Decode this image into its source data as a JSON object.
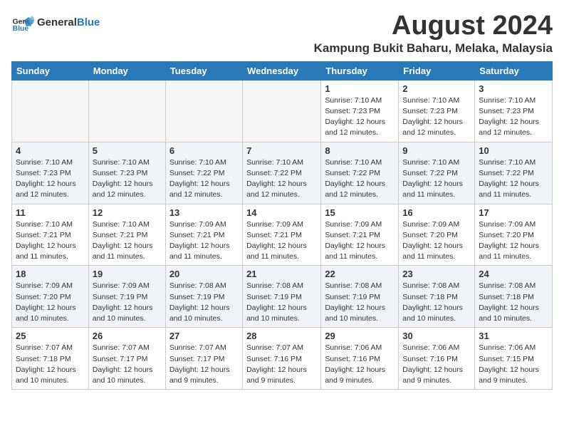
{
  "logo": {
    "general": "General",
    "blue": "Blue"
  },
  "header": {
    "title": "August 2024",
    "subtitle": "Kampung Bukit Baharu, Melaka, Malaysia"
  },
  "weekdays": [
    "Sunday",
    "Monday",
    "Tuesday",
    "Wednesday",
    "Thursday",
    "Friday",
    "Saturday"
  ],
  "weeks": [
    [
      {
        "day": "",
        "info": ""
      },
      {
        "day": "",
        "info": ""
      },
      {
        "day": "",
        "info": ""
      },
      {
        "day": "",
        "info": ""
      },
      {
        "day": "1",
        "info": "Sunrise: 7:10 AM\nSunset: 7:23 PM\nDaylight: 12 hours\nand 12 minutes."
      },
      {
        "day": "2",
        "info": "Sunrise: 7:10 AM\nSunset: 7:23 PM\nDaylight: 12 hours\nand 12 minutes."
      },
      {
        "day": "3",
        "info": "Sunrise: 7:10 AM\nSunset: 7:23 PM\nDaylight: 12 hours\nand 12 minutes."
      }
    ],
    [
      {
        "day": "4",
        "info": "Sunrise: 7:10 AM\nSunset: 7:23 PM\nDaylight: 12 hours\nand 12 minutes."
      },
      {
        "day": "5",
        "info": "Sunrise: 7:10 AM\nSunset: 7:23 PM\nDaylight: 12 hours\nand 12 minutes."
      },
      {
        "day": "6",
        "info": "Sunrise: 7:10 AM\nSunset: 7:22 PM\nDaylight: 12 hours\nand 12 minutes."
      },
      {
        "day": "7",
        "info": "Sunrise: 7:10 AM\nSunset: 7:22 PM\nDaylight: 12 hours\nand 12 minutes."
      },
      {
        "day": "8",
        "info": "Sunrise: 7:10 AM\nSunset: 7:22 PM\nDaylight: 12 hours\nand 12 minutes."
      },
      {
        "day": "9",
        "info": "Sunrise: 7:10 AM\nSunset: 7:22 PM\nDaylight: 12 hours\nand 11 minutes."
      },
      {
        "day": "10",
        "info": "Sunrise: 7:10 AM\nSunset: 7:22 PM\nDaylight: 12 hours\nand 11 minutes."
      }
    ],
    [
      {
        "day": "11",
        "info": "Sunrise: 7:10 AM\nSunset: 7:21 PM\nDaylight: 12 hours\nand 11 minutes."
      },
      {
        "day": "12",
        "info": "Sunrise: 7:10 AM\nSunset: 7:21 PM\nDaylight: 12 hours\nand 11 minutes."
      },
      {
        "day": "13",
        "info": "Sunrise: 7:09 AM\nSunset: 7:21 PM\nDaylight: 12 hours\nand 11 minutes."
      },
      {
        "day": "14",
        "info": "Sunrise: 7:09 AM\nSunset: 7:21 PM\nDaylight: 12 hours\nand 11 minutes."
      },
      {
        "day": "15",
        "info": "Sunrise: 7:09 AM\nSunset: 7:21 PM\nDaylight: 12 hours\nand 11 minutes."
      },
      {
        "day": "16",
        "info": "Sunrise: 7:09 AM\nSunset: 7:20 PM\nDaylight: 12 hours\nand 11 minutes."
      },
      {
        "day": "17",
        "info": "Sunrise: 7:09 AM\nSunset: 7:20 PM\nDaylight: 12 hours\nand 11 minutes."
      }
    ],
    [
      {
        "day": "18",
        "info": "Sunrise: 7:09 AM\nSunset: 7:20 PM\nDaylight: 12 hours\nand 10 minutes."
      },
      {
        "day": "19",
        "info": "Sunrise: 7:09 AM\nSunset: 7:19 PM\nDaylight: 12 hours\nand 10 minutes."
      },
      {
        "day": "20",
        "info": "Sunrise: 7:08 AM\nSunset: 7:19 PM\nDaylight: 12 hours\nand 10 minutes."
      },
      {
        "day": "21",
        "info": "Sunrise: 7:08 AM\nSunset: 7:19 PM\nDaylight: 12 hours\nand 10 minutes."
      },
      {
        "day": "22",
        "info": "Sunrise: 7:08 AM\nSunset: 7:19 PM\nDaylight: 12 hours\nand 10 minutes."
      },
      {
        "day": "23",
        "info": "Sunrise: 7:08 AM\nSunset: 7:18 PM\nDaylight: 12 hours\nand 10 minutes."
      },
      {
        "day": "24",
        "info": "Sunrise: 7:08 AM\nSunset: 7:18 PM\nDaylight: 12 hours\nand 10 minutes."
      }
    ],
    [
      {
        "day": "25",
        "info": "Sunrise: 7:07 AM\nSunset: 7:18 PM\nDaylight: 12 hours\nand 10 minutes."
      },
      {
        "day": "26",
        "info": "Sunrise: 7:07 AM\nSunset: 7:17 PM\nDaylight: 12 hours\nand 10 minutes."
      },
      {
        "day": "27",
        "info": "Sunrise: 7:07 AM\nSunset: 7:17 PM\nDaylight: 12 hours\nand 9 minutes."
      },
      {
        "day": "28",
        "info": "Sunrise: 7:07 AM\nSunset: 7:16 PM\nDaylight: 12 hours\nand 9 minutes."
      },
      {
        "day": "29",
        "info": "Sunrise: 7:06 AM\nSunset: 7:16 PM\nDaylight: 12 hours\nand 9 minutes."
      },
      {
        "day": "30",
        "info": "Sunrise: 7:06 AM\nSunset: 7:16 PM\nDaylight: 12 hours\nand 9 minutes."
      },
      {
        "day": "31",
        "info": "Sunrise: 7:06 AM\nSunset: 7:15 PM\nDaylight: 12 hours\nand 9 minutes."
      }
    ]
  ]
}
